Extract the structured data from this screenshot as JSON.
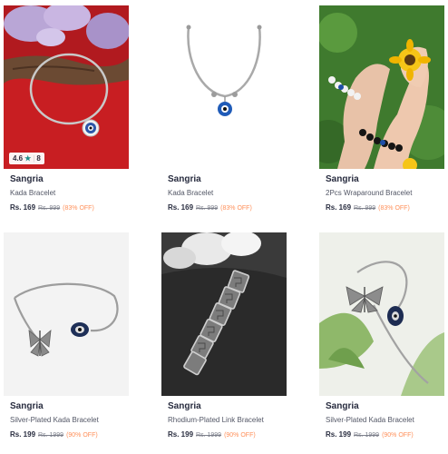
{
  "colors": {
    "brand_text": "#282c3f",
    "product_text": "#535766",
    "discount": "#ff905a",
    "rating_star": "#14958f"
  },
  "products": [
    {
      "brand": "Sangria",
      "name": "Kada Bracelet",
      "price": "Rs. 169",
      "mrp": "Rs. 999",
      "discount": "(83% OFF)",
      "rating": {
        "value": "4.6",
        "star_icon": "star-icon",
        "count": "8"
      }
    },
    {
      "brand": "Sangria",
      "name": "Kada Bracelet",
      "price": "Rs. 169",
      "mrp": "Rs. 999",
      "discount": "(83% OFF)"
    },
    {
      "brand": "Sangria",
      "name": "2Pcs Wraparound Bracelet",
      "price": "Rs. 169",
      "mrp": "Rs. 999",
      "discount": "(83% OFF)"
    },
    {
      "brand": "Sangria",
      "name": "Silver-Plated Kada Bracelet",
      "price": "Rs. 199",
      "mrp": "Rs. 1999",
      "discount": "(90% OFF)"
    },
    {
      "brand": "Sangria",
      "name": "Rhodium-Plated Link Bracelet",
      "price": "Rs. 199",
      "mrp": "Rs. 1999",
      "discount": "(90% OFF)"
    },
    {
      "brand": "Sangria",
      "name": "Silver-Plated Kada Bracelet",
      "price": "Rs. 199",
      "mrp": "Rs. 1999",
      "discount": "(90% OFF)"
    }
  ]
}
